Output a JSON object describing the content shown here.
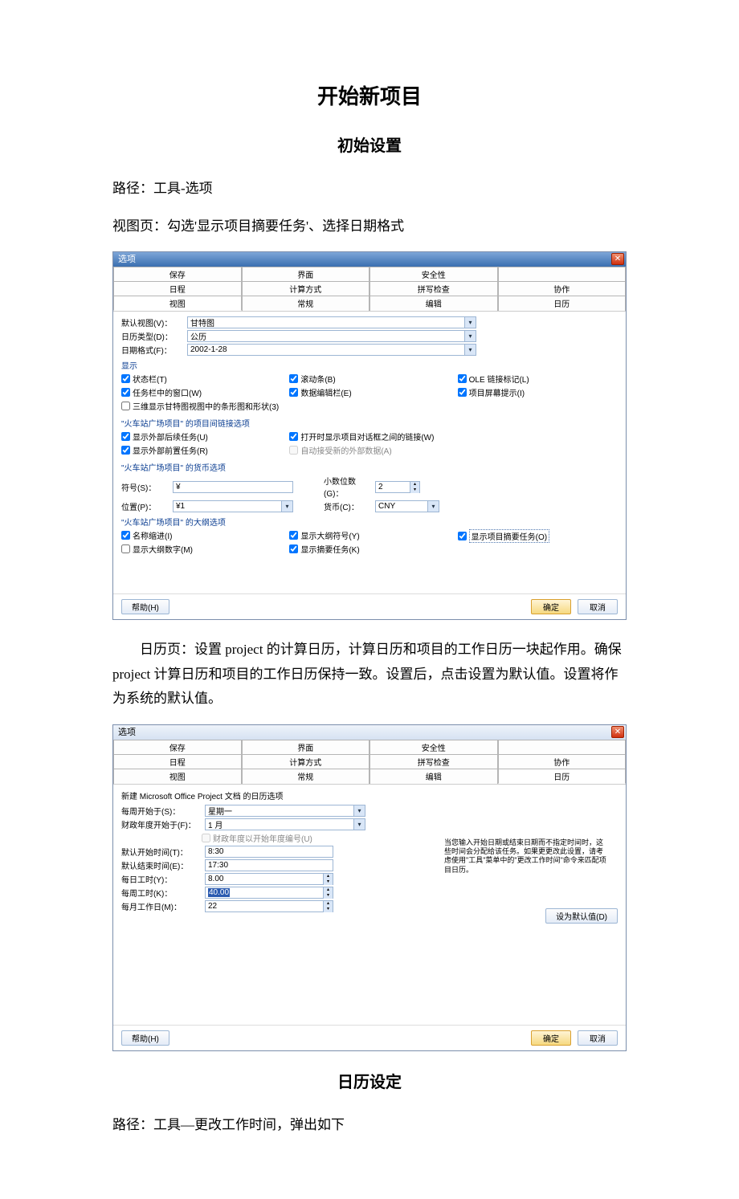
{
  "doc": {
    "title": "开始新项目",
    "subtitle1": "初始设置",
    "path1": "路径：工具-选项",
    "viewpage": "视图页：勾选'显示项目摘要任务'、选择日期格式",
    "calendar_para": "日历页：设置 project 的计算日历，计算日历和项目的工作日历一块起作用。确保project 计算日历和项目的工作日历保持一致。设置后，点击设置为默认值。设置将作为系统的默认值。",
    "subtitle2": "日历设定",
    "path2": "路径：工具—更改工作时间，弹出如下"
  },
  "dlg1": {
    "title": "选项",
    "close": "✕",
    "tabs_row1": [
      "保存",
      "界面",
      "安全性",
      ""
    ],
    "tabs_row2": [
      "日程",
      "计算方式",
      "拼写检查",
      "协作"
    ],
    "tabs_row3": [
      "视图",
      "常规",
      "编辑",
      "日历"
    ],
    "default_view_lbl": "默认视图(V)：",
    "default_view_val": "甘特图",
    "cal_type_lbl": "日历类型(D)：",
    "cal_type_val": "公历",
    "date_fmt_lbl": "日期格式(F)：",
    "date_fmt_val": "2002-1-28",
    "display_section": "显示",
    "chk_statusbar": "状态栏(T)",
    "chk_taskbar_window": "任务栏中的窗口(W)",
    "chk_3d_bars": "三维显示甘特图视图中的条形图和形状(3)",
    "chk_scrollbar": "滚动条(B)",
    "chk_data_editbar": "数据编辑栏(E)",
    "chk_ole_link": "OLE 链接标记(L)",
    "chk_proj_screentip": "项目屏幕提示(I)",
    "link_section": "\"火车站广场项目\" 的项目间链接选项",
    "chk_show_ext_succ": "显示外部后续任务(U)",
    "chk_show_ext_pred": "显示外部前置任务(R)",
    "chk_open_link_dialog": "打开时显示项目对话框之间的链接(W)",
    "chk_auto_accept": "自动接受新的外部数据(A)",
    "currency_section": "\"火车站广场项目\" 的货币选项",
    "symbol_lbl": "符号(S)：",
    "symbol_val": "¥",
    "decimals_lbl": "小数位数(G)：",
    "decimals_val": "2",
    "position_lbl": "位置(P)：",
    "position_val": "¥1",
    "currency_lbl2": "货币(C)：",
    "currency_val2": "CNY",
    "outline_section": "\"火车站广场项目\" 的大纲选项",
    "chk_name_indent": "名称缩进(I)",
    "chk_show_outline_num": "显示大纲数字(M)",
    "chk_show_outline_sym": "显示大纲符号(Y)",
    "chk_show_summary": "显示摘要任务(K)",
    "chk_show_proj_summary": "显示项目摘要任务(O)",
    "help_btn": "帮助(H)",
    "ok_btn": "确定",
    "cancel_btn": "取消"
  },
  "dlg2": {
    "title": "选项",
    "close": "✕",
    "tabs_row1": [
      "保存",
      "界面",
      "安全性",
      ""
    ],
    "tabs_row2": [
      "日程",
      "计算方式",
      "拼写检查",
      "协作"
    ],
    "tabs_row3": [
      "视图",
      "常规",
      "编辑",
      "日历"
    ],
    "new_cal_opts": "新建 Microsoft Office Project 文档 的日历选项",
    "week_start_lbl": "每周开始于(S)：",
    "week_start_val": "星期一",
    "fy_start_lbl": "财政年度开始于(F)：",
    "fy_start_val": "1 月",
    "chk_fy_numbering": "财政年度以开始年度编号(U)",
    "def_start_lbl": "默认开始时间(T)：",
    "def_start_val": "8:30",
    "def_end_lbl": "默认结束时间(E)：",
    "def_end_val": "17:30",
    "hrs_day_lbl": "每日工时(Y)：",
    "hrs_day_val": "8.00",
    "hrs_week_lbl": "每周工时(K)：",
    "hrs_week_val": "40.00",
    "days_month_lbl": "每月工作日(M)：",
    "days_month_val": "22",
    "info_text": "当您输入开始日期或结束日期而不指定时间时，这些时间会分配给该任务。如果更更改此设置，请考虑使用\"工具\"菜单中的\"更改工作时间\"命令来匹配项目日历。",
    "set_default_btn": "设为默认值(D)",
    "help_btn": "帮助(H)",
    "ok_btn": "确定",
    "cancel_btn": "取消"
  }
}
